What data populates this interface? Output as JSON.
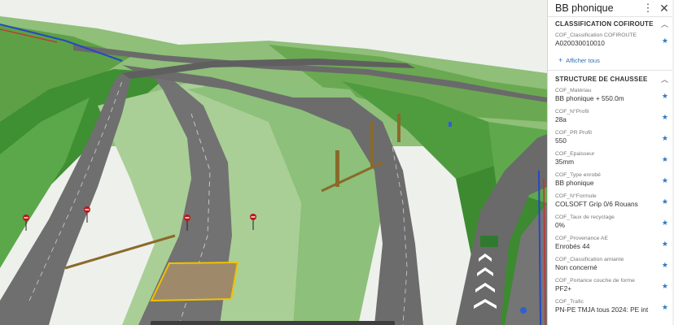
{
  "panel": {
    "title": "BB phonique",
    "more_icon": "more-vertical-icon",
    "close_icon": "close-icon",
    "sections": [
      {
        "title": "CLASSIFICATION COFIROUTE",
        "fields": [
          {
            "label": "COF_Classification COFIROUTE",
            "value": "A020030010010"
          }
        ],
        "show_all": "Afficher tous"
      },
      {
        "title": "STRUCTURE DE CHAUSSEE",
        "fields": [
          {
            "label": "COF_Matériau",
            "value": "BB phonique + 550.0m"
          },
          {
            "label": "COF_N°Profil",
            "value": "28a"
          },
          {
            "label": "COF_PR Profil",
            "value": "550"
          },
          {
            "label": "COF_Epaisseur",
            "value": "35mm"
          },
          {
            "label": "COF_Type enrobé",
            "value": "BB phonique"
          },
          {
            "label": "COF_N°Formule",
            "value": "COLSOFT Grip 0/6 Rouans"
          },
          {
            "label": "COF_Taux de recyclage",
            "value": "0%"
          },
          {
            "label": "COF_Provenance AE",
            "value": "Enrobés 44"
          },
          {
            "label": "COF_Classification amiante",
            "value": "Non concerné"
          },
          {
            "label": "COF_Portance couche de forme",
            "value": "PF2+"
          },
          {
            "label": "COF_Trafic",
            "value": "PN-PE TMJA tous 2024: PE int"
          }
        ]
      }
    ]
  },
  "viewport": {
    "content": "3D road interchange model",
    "accent_color": "#2f78c4",
    "selection_color": "#f2c200",
    "grass_color": "#4e9a3c",
    "road_color": "#6f6f6f"
  }
}
